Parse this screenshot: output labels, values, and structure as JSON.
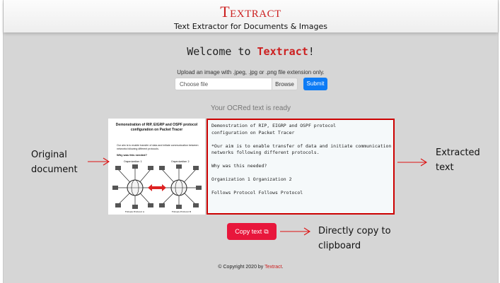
{
  "header": {
    "brand": "Textract",
    "tagline": "Text Extractor for Documents & Images"
  },
  "welcome": {
    "prefix": "Welcome to ",
    "brand": "Textract",
    "suffix": "!"
  },
  "upload": {
    "hint": "Upload an image with .jpeg, .jpg or .png file extension only.",
    "file_placeholder": "Choose file",
    "browse_label": "Browse",
    "submit_label": "Submit"
  },
  "result": {
    "status": "Your OCRed text is ready",
    "extracted_lines": [
      "Demonstration of RIP, EIGRP and OSPF protocol",
      "configuration on Packet Tracer",
      "",
      "*Our aim is to enable transfer of data and initiate communication between",
      "networks following different protocols.",
      "",
      "Why was this needed?",
      "",
      "Organization 1 Organization 2",
      "",
      "Follows Protocol Follows Protocol"
    ],
    "copy_label": "Copy text"
  },
  "document_preview": {
    "title_line1": "Demonstration of RIP, EIGRP and OSPF protocol",
    "title_line2": "configuration on Packet Tracer",
    "body": "Our aim is to enable transfer of data and initiate communication between networks following different protocols.",
    "subheading": "Why was this needed?",
    "org1": "Organization 1",
    "org2": "Organization 2",
    "follows1": "Follows Protocol A",
    "follows2": "Follows Protocol B"
  },
  "annotations": {
    "original_line1": "Original",
    "original_line2": "document",
    "extracted_line1": "Extracted",
    "extracted_line2": "text",
    "copy_line1": "Directly copy to",
    "copy_line2": "clipboard"
  },
  "footer": {
    "prefix": "© Copyright 2020 by ",
    "brand": "Textract",
    "suffix": "."
  },
  "icons": {
    "copy": "clipboard-icon",
    "arrow": "arrow-icon"
  },
  "colors": {
    "brand_red": "#cc1f1f",
    "submit_blue": "#0d7bf5",
    "copy_red": "#e8173c",
    "textbox_border": "#cc0000"
  }
}
